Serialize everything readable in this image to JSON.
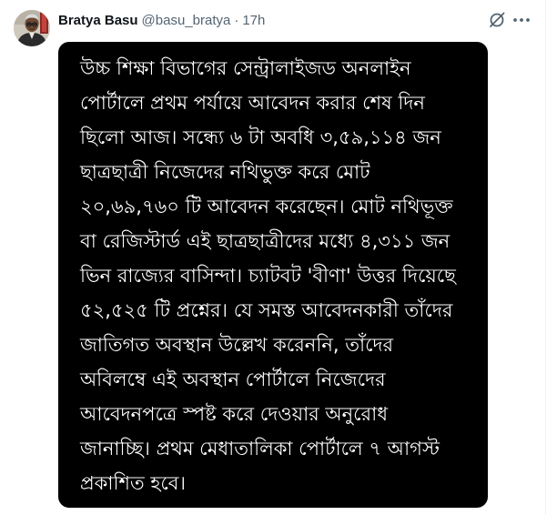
{
  "author": {
    "display_name": "Bratya Basu",
    "handle": "@basu_bratya",
    "separator": "·",
    "time": "17h"
  },
  "icons": {
    "avatar": "profile-photo",
    "grok": "grok-slash-circle-icon",
    "more": "more-horizontal-icon"
  },
  "post": {
    "image_text": "উচ্চ শিক্ষা বিভাগের সেন্ট্রালাইজড অনলাইন\nপোর্টালে প্রথম পর্যায়ে আবেদন করার শেষ দিন\nছিলো আজ। সন্ধ্যে ৬ টা অবধি ৩,৫৯,১১৪ জন\nছাত্রছাত্রী নিজেদের নথিভুক্ত করে মোট\n২০,৬৯,৭৬০ টি আবেদন করেছেন। মোট নথিভূক্ত\nবা রেজিস্টার্ড এই ছাত্রছাত্রীদের মধ্যে ৪,৩১১ জন\nভিন রাজ্যের বাসিন্দা। চ্যাটবট 'বীণা' উত্তর দিয়েছে\n৫২,৫২৫ টি প্রশ্নের। যে সমস্ত আবেদনকারী তাঁদের\nজাতিগত অবস্থান উল্লেখ করেননি, তাঁদের\nঅবিলম্বে এই অবস্থান পোর্টালে নিজেদের\nআবেদনপত্রে স্পষ্ট করে দেওয়ার অনুরোধ\nজানাচ্ছি। প্রথম মেধাতালিকা পোর্টালে ৭ আগস্ট\nপ্রকাশিত হবে।"
  },
  "colors": {
    "text_primary": "#0f1419",
    "text_secondary": "#536471",
    "image_background": "#000000",
    "image_text": "#ffffff"
  }
}
